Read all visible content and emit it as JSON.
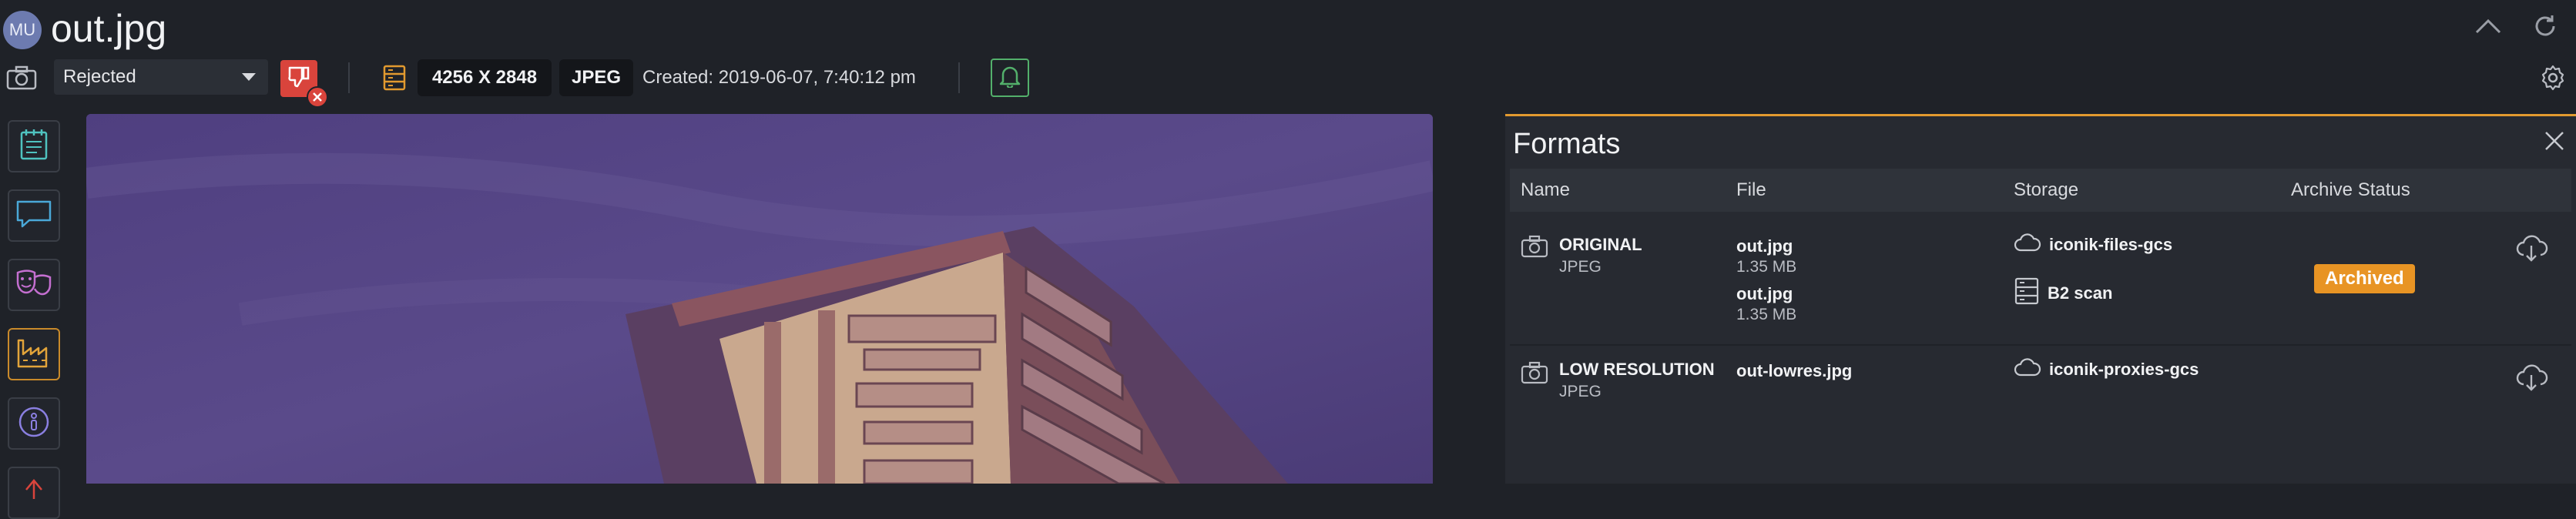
{
  "header": {
    "avatar_initials": "MU",
    "title": "out.jpg",
    "icons": [
      "chevron-up-icon",
      "refresh-icon"
    ]
  },
  "toolbar": {
    "status_value": "Rejected",
    "dimensions": "4256 X 2848",
    "format": "JPEG",
    "created": "Created: 2019-06-07, 7:40:12 pm",
    "icons": [
      "camera-icon",
      "thumbs-down-icon",
      "metadata-icon",
      "bell-icon",
      "settings-icon"
    ]
  },
  "sidebar": {
    "items": [
      {
        "icon": "notes-icon",
        "color": "#4fc3c0"
      },
      {
        "icon": "comment-icon",
        "color": "#4aa8d8"
      },
      {
        "icon": "masks-icon",
        "color": "#c46fd0"
      },
      {
        "icon": "factory-icon",
        "color": "#e2a43a"
      },
      {
        "icon": "info-icon",
        "color": "#8a7fe0"
      },
      {
        "icon": "share-icon",
        "color": "#d9443c"
      }
    ]
  },
  "formats_panel": {
    "title": "Formats",
    "columns": [
      "Name",
      "File",
      "Storage",
      "Archive Status"
    ],
    "rows": [
      {
        "name": "ORIGINAL",
        "type": "JPEG",
        "files": [
          {
            "name": "out.jpg",
            "size": "1.35 MB"
          },
          {
            "name": "out.jpg",
            "size": "1.35 MB"
          }
        ],
        "storage": [
          {
            "icon": "cloud-icon",
            "label": "iconik-files-gcs"
          },
          {
            "icon": "server-icon",
            "label": "B2 scan"
          }
        ],
        "archive_status": "Archived"
      },
      {
        "name": "LOW RESOLUTION",
        "type": "JPEG",
        "files": [
          {
            "name": "out-lowres.jpg"
          }
        ],
        "storage": [
          {
            "icon": "cloud-icon",
            "label": "iconik-proxies-gcs"
          }
        ],
        "archive_status": ""
      }
    ]
  },
  "colors": {
    "background": "#1f2228",
    "panel": "#272a31",
    "accent": "#e29a2f",
    "rejected": "#d9443c",
    "notify": "#53b06b"
  }
}
